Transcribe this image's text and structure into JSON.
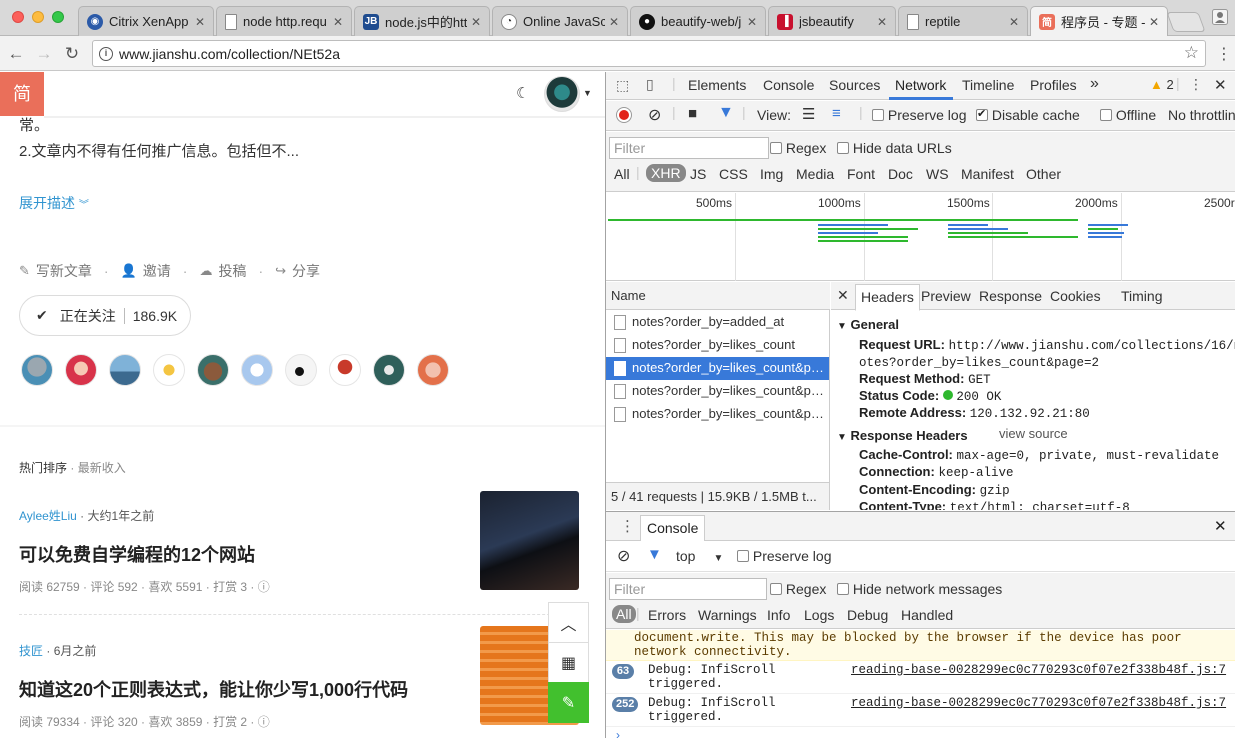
{
  "browser": {
    "tabs": [
      {
        "title": "Citrix XenApp",
        "favicon": "citrix-icon",
        "color": "#2b5aa8"
      },
      {
        "title": "node http.requ",
        "favicon": "document-icon",
        "color": "#ffffff"
      },
      {
        "title": "node.js中的htt",
        "favicon": "jetbrains-icon",
        "color": "#1f4c8f"
      },
      {
        "title": "Online JavaSc",
        "favicon": "owl-icon",
        "color": "#ffffff"
      },
      {
        "title": "beautify-web/j",
        "favicon": "github-icon",
        "color": "#111111"
      },
      {
        "title": "jsbeautify",
        "favicon": "jsbeautify-icon",
        "color": "#c8102e"
      },
      {
        "title": "reptile",
        "favicon": "document-icon",
        "color": "#ffffff"
      },
      {
        "title": "程序员 - 专题 -",
        "favicon": "jianshu-icon",
        "color": "#ea6f5a",
        "active": true
      }
    ],
    "url": "www.jianshu.com/collection/NEt52a"
  },
  "page": {
    "logo": "简",
    "desc_line1": "常。",
    "desc_line2": "2.文章内不得有任何推广信息。包括但不...",
    "expand_label": "展开描述",
    "actions": {
      "write": "写新文章",
      "invite": "邀请",
      "submit": "投稿",
      "share": "分享"
    },
    "follow": {
      "label": "正在关注",
      "count": "186.9K"
    },
    "sort": {
      "hot": "热门排序",
      "latest": "最新收入"
    },
    "articles": [
      {
        "author": "Aylee姓Liu",
        "time": "大约1年之前",
        "title": "可以免费自学编程的12个网站",
        "stats": "阅读 62759 · 评论 592 · 喜欢 5591 · 打赏 3 ·"
      },
      {
        "author": "技匠",
        "time": "6月之前",
        "title": "知道这20个正则表达式，能让你少写1,000行代码",
        "stats": "阅读 79334 · 评论 320 · 喜欢 3859 · 打赏 2 ·"
      }
    ],
    "accent": "#ea6f5a",
    "link_color": "#3194d0",
    "green": "#42c02e"
  },
  "devtools": {
    "tabs": [
      "Elements",
      "Console",
      "Sources",
      "Network",
      "Timeline",
      "Profiles"
    ],
    "more": "»",
    "active_tab": "Network",
    "warnings": "2",
    "network_toolbar": {
      "view_label": "View:",
      "preserve_log": "Preserve log",
      "disable_cache": "Disable cache",
      "offline": "Offline",
      "throttling": "No throttlin"
    },
    "filter": {
      "placeholder": "Filter",
      "regex": "Regex",
      "hide_data_urls": "Hide data URLs",
      "types": [
        "All",
        "XHR",
        "JS",
        "CSS",
        "Img",
        "Media",
        "Font",
        "Doc",
        "WS",
        "Manifest",
        "Other"
      ],
      "active_type": "XHR"
    },
    "timeline_ticks": [
      "500ms",
      "1000ms",
      "1500ms",
      "2000ms",
      "2500r"
    ],
    "requests": {
      "header": "Name",
      "rows": [
        "notes?order_by=added_at",
        "notes?order_by=likes_count",
        "notes?order_by=likes_count&pag...",
        "notes?order_by=likes_count&pag...",
        "notes?order_by=likes_count&pag..."
      ],
      "selected_index": 2,
      "summary": "5 / 41 requests | 15.9KB / 1.5MB t..."
    },
    "detail": {
      "tabs": [
        "Headers",
        "Preview",
        "Response",
        "Cookies",
        "Timing"
      ],
      "active_tab": "Headers",
      "general_title": "General",
      "request_url_label": "Request URL:",
      "request_url_1": "http://www.jianshu.com/collections/16/n",
      "request_url_2": "otes?order_by=likes_count&page=2",
      "method_label": "Request Method:",
      "method": "GET",
      "status_label": "Status Code:",
      "status": "200 OK",
      "remote_label": "Remote Address:",
      "remote": "120.132.92.21:80",
      "response_title": "Response Headers",
      "view_source": "view source",
      "cache_label": "Cache-Control:",
      "cache": "max-age=0, private, must-revalidate",
      "conn_label": "Connection:",
      "conn": "keep-alive",
      "enc_label": "Content-Encoding:",
      "enc": "gzip",
      "ctype_label": "Content-Type:",
      "ctype": "text/html; charset=utf-8"
    },
    "console": {
      "tab": "Console",
      "context": "top",
      "preserve_log": "Preserve log",
      "filter_placeholder": "Filter",
      "regex": "Regex",
      "hide_network": "Hide network messages",
      "levels": [
        "All",
        "Errors",
        "Warnings",
        "Info",
        "Logs",
        "Debug",
        "Handled"
      ],
      "messages": [
        {
          "type": "warn",
          "text": "document.write. This may be blocked by the browser if the device has poor\nnetwork connectivity."
        },
        {
          "type": "debug",
          "count": "63",
          "text": "Debug: InfiScroll\ntriggered.",
          "source": "reading-base-0028299ec0c770293c0f07e2f338b48f.js:7"
        },
        {
          "type": "debug",
          "count": "252",
          "text": "Debug: InfiScroll\ntriggered.",
          "source": "reading-base-0028299ec0c770293c0f07e2f338b48f.js:7"
        }
      ]
    }
  }
}
